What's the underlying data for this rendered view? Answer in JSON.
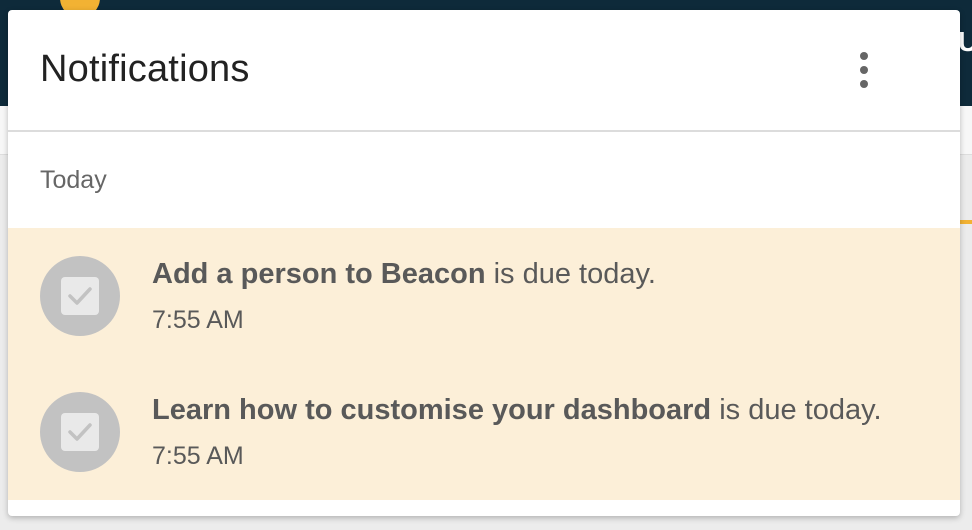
{
  "background": {
    "header_color": "#0e2a3a",
    "accent_color": "#f2b233",
    "edge_text": "UT"
  },
  "panel": {
    "title": "Notifications",
    "more_icon": "more-vertical-icon",
    "section_label": "Today",
    "unread_background": "#fcefd8"
  },
  "notifications": [
    {
      "icon": "checkbox-checked-icon",
      "title": "Add a person to Beacon",
      "suffix": " is due today.",
      "time": "7:55 AM"
    },
    {
      "icon": "checkbox-checked-icon",
      "title": "Learn how to customise your dashboard",
      "suffix": " is due today.",
      "time": "7:55 AM"
    }
  ]
}
